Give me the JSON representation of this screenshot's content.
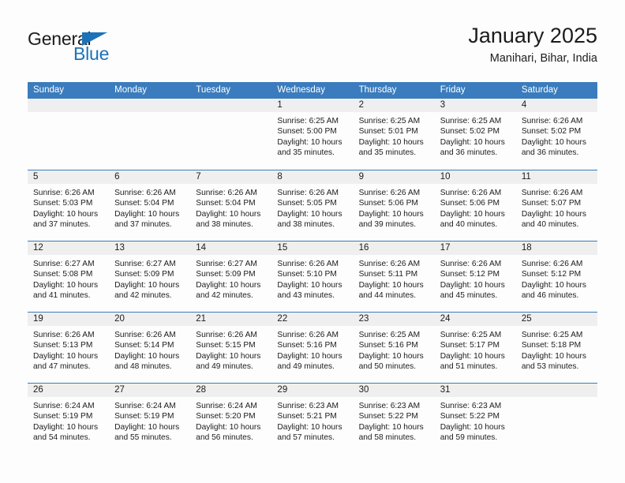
{
  "brand": {
    "name_part1": "General",
    "name_part2": "Blue",
    "triangle_color": "#1c72b8"
  },
  "header": {
    "title": "January 2025",
    "location": "Manihari, Bihar, India"
  },
  "theme": {
    "header_blue": "#3a7cbd",
    "day_band_gray": "#efefef",
    "text": "#1c1c1c"
  },
  "weekday_headers": [
    "Sunday",
    "Monday",
    "Tuesday",
    "Wednesday",
    "Thursday",
    "Friday",
    "Saturday"
  ],
  "labels": {
    "sunrise": "Sunrise:",
    "sunset": "Sunset:",
    "daylight": "Daylight:"
  },
  "weeks": [
    [
      {
        "empty": true
      },
      {
        "empty": true
      },
      {
        "empty": true
      },
      {
        "day": "1",
        "sunrise": "Sunrise: 6:25 AM",
        "sunset": "Sunset: 5:00 PM",
        "daylight_l1": "Daylight: 10 hours",
        "daylight_l2": "and 35 minutes."
      },
      {
        "day": "2",
        "sunrise": "Sunrise: 6:25 AM",
        "sunset": "Sunset: 5:01 PM",
        "daylight_l1": "Daylight: 10 hours",
        "daylight_l2": "and 35 minutes."
      },
      {
        "day": "3",
        "sunrise": "Sunrise: 6:25 AM",
        "sunset": "Sunset: 5:02 PM",
        "daylight_l1": "Daylight: 10 hours",
        "daylight_l2": "and 36 minutes."
      },
      {
        "day": "4",
        "sunrise": "Sunrise: 6:26 AM",
        "sunset": "Sunset: 5:02 PM",
        "daylight_l1": "Daylight: 10 hours",
        "daylight_l2": "and 36 minutes."
      }
    ],
    [
      {
        "day": "5",
        "sunrise": "Sunrise: 6:26 AM",
        "sunset": "Sunset: 5:03 PM",
        "daylight_l1": "Daylight: 10 hours",
        "daylight_l2": "and 37 minutes."
      },
      {
        "day": "6",
        "sunrise": "Sunrise: 6:26 AM",
        "sunset": "Sunset: 5:04 PM",
        "daylight_l1": "Daylight: 10 hours",
        "daylight_l2": "and 37 minutes."
      },
      {
        "day": "7",
        "sunrise": "Sunrise: 6:26 AM",
        "sunset": "Sunset: 5:04 PM",
        "daylight_l1": "Daylight: 10 hours",
        "daylight_l2": "and 38 minutes."
      },
      {
        "day": "8",
        "sunrise": "Sunrise: 6:26 AM",
        "sunset": "Sunset: 5:05 PM",
        "daylight_l1": "Daylight: 10 hours",
        "daylight_l2": "and 38 minutes."
      },
      {
        "day": "9",
        "sunrise": "Sunrise: 6:26 AM",
        "sunset": "Sunset: 5:06 PM",
        "daylight_l1": "Daylight: 10 hours",
        "daylight_l2": "and 39 minutes."
      },
      {
        "day": "10",
        "sunrise": "Sunrise: 6:26 AM",
        "sunset": "Sunset: 5:06 PM",
        "daylight_l1": "Daylight: 10 hours",
        "daylight_l2": "and 40 minutes."
      },
      {
        "day": "11",
        "sunrise": "Sunrise: 6:26 AM",
        "sunset": "Sunset: 5:07 PM",
        "daylight_l1": "Daylight: 10 hours",
        "daylight_l2": "and 40 minutes."
      }
    ],
    [
      {
        "day": "12",
        "sunrise": "Sunrise: 6:27 AM",
        "sunset": "Sunset: 5:08 PM",
        "daylight_l1": "Daylight: 10 hours",
        "daylight_l2": "and 41 minutes."
      },
      {
        "day": "13",
        "sunrise": "Sunrise: 6:27 AM",
        "sunset": "Sunset: 5:09 PM",
        "daylight_l1": "Daylight: 10 hours",
        "daylight_l2": "and 42 minutes."
      },
      {
        "day": "14",
        "sunrise": "Sunrise: 6:27 AM",
        "sunset": "Sunset: 5:09 PM",
        "daylight_l1": "Daylight: 10 hours",
        "daylight_l2": "and 42 minutes."
      },
      {
        "day": "15",
        "sunrise": "Sunrise: 6:26 AM",
        "sunset": "Sunset: 5:10 PM",
        "daylight_l1": "Daylight: 10 hours",
        "daylight_l2": "and 43 minutes."
      },
      {
        "day": "16",
        "sunrise": "Sunrise: 6:26 AM",
        "sunset": "Sunset: 5:11 PM",
        "daylight_l1": "Daylight: 10 hours",
        "daylight_l2": "and 44 minutes."
      },
      {
        "day": "17",
        "sunrise": "Sunrise: 6:26 AM",
        "sunset": "Sunset: 5:12 PM",
        "daylight_l1": "Daylight: 10 hours",
        "daylight_l2": "and 45 minutes."
      },
      {
        "day": "18",
        "sunrise": "Sunrise: 6:26 AM",
        "sunset": "Sunset: 5:12 PM",
        "daylight_l1": "Daylight: 10 hours",
        "daylight_l2": "and 46 minutes."
      }
    ],
    [
      {
        "day": "19",
        "sunrise": "Sunrise: 6:26 AM",
        "sunset": "Sunset: 5:13 PM",
        "daylight_l1": "Daylight: 10 hours",
        "daylight_l2": "and 47 minutes."
      },
      {
        "day": "20",
        "sunrise": "Sunrise: 6:26 AM",
        "sunset": "Sunset: 5:14 PM",
        "daylight_l1": "Daylight: 10 hours",
        "daylight_l2": "and 48 minutes."
      },
      {
        "day": "21",
        "sunrise": "Sunrise: 6:26 AM",
        "sunset": "Sunset: 5:15 PM",
        "daylight_l1": "Daylight: 10 hours",
        "daylight_l2": "and 49 minutes."
      },
      {
        "day": "22",
        "sunrise": "Sunrise: 6:26 AM",
        "sunset": "Sunset: 5:16 PM",
        "daylight_l1": "Daylight: 10 hours",
        "daylight_l2": "and 49 minutes."
      },
      {
        "day": "23",
        "sunrise": "Sunrise: 6:25 AM",
        "sunset": "Sunset: 5:16 PM",
        "daylight_l1": "Daylight: 10 hours",
        "daylight_l2": "and 50 minutes."
      },
      {
        "day": "24",
        "sunrise": "Sunrise: 6:25 AM",
        "sunset": "Sunset: 5:17 PM",
        "daylight_l1": "Daylight: 10 hours",
        "daylight_l2": "and 51 minutes."
      },
      {
        "day": "25",
        "sunrise": "Sunrise: 6:25 AM",
        "sunset": "Sunset: 5:18 PM",
        "daylight_l1": "Daylight: 10 hours",
        "daylight_l2": "and 53 minutes."
      }
    ],
    [
      {
        "day": "26",
        "sunrise": "Sunrise: 6:24 AM",
        "sunset": "Sunset: 5:19 PM",
        "daylight_l1": "Daylight: 10 hours",
        "daylight_l2": "and 54 minutes."
      },
      {
        "day": "27",
        "sunrise": "Sunrise: 6:24 AM",
        "sunset": "Sunset: 5:19 PM",
        "daylight_l1": "Daylight: 10 hours",
        "daylight_l2": "and 55 minutes."
      },
      {
        "day": "28",
        "sunrise": "Sunrise: 6:24 AM",
        "sunset": "Sunset: 5:20 PM",
        "daylight_l1": "Daylight: 10 hours",
        "daylight_l2": "and 56 minutes."
      },
      {
        "day": "29",
        "sunrise": "Sunrise: 6:23 AM",
        "sunset": "Sunset: 5:21 PM",
        "daylight_l1": "Daylight: 10 hours",
        "daylight_l2": "and 57 minutes."
      },
      {
        "day": "30",
        "sunrise": "Sunrise: 6:23 AM",
        "sunset": "Sunset: 5:22 PM",
        "daylight_l1": "Daylight: 10 hours",
        "daylight_l2": "and 58 minutes."
      },
      {
        "day": "31",
        "sunrise": "Sunrise: 6:23 AM",
        "sunset": "Sunset: 5:22 PM",
        "daylight_l1": "Daylight: 10 hours",
        "daylight_l2": "and 59 minutes."
      },
      {
        "empty": true
      }
    ]
  ]
}
